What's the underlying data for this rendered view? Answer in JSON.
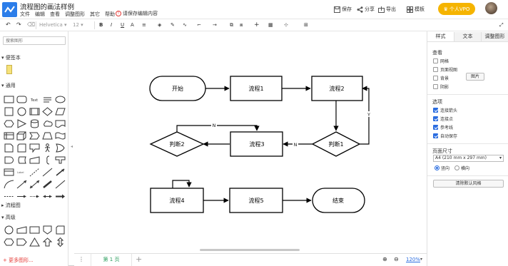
{
  "header": {
    "title": "流程图的画法样例",
    "menu": [
      "文件",
      "编辑",
      "查看",
      "调整图形",
      "其它",
      "帮助"
    ],
    "save_warning": "请保存编辑内容",
    "save": "保存",
    "share": "分享",
    "export": "导出",
    "template": "模板",
    "vip": "个人VPO"
  },
  "toolbar": {
    "font": "Helvetica",
    "font_size": "12"
  },
  "left_panel": {
    "search_placeholder": "搜索图形",
    "sections": [
      "便签本",
      "通用",
      "流程图",
      "高级"
    ],
    "more_shapes": "+ 更多图形..."
  },
  "diagram": {
    "start": "开始",
    "process1": "流程1",
    "process2": "流程2",
    "decision1": "判断1",
    "process3": "流程3",
    "decision2": "判断2",
    "process4": "流程4",
    "process5": "流程5",
    "end": "结束",
    "label_n1": "N",
    "label_n2": "N",
    "label_y": "Y"
  },
  "bottom": {
    "page_tab": "第 1 页",
    "zoom": "120%"
  },
  "right_panel": {
    "tabs": [
      "样式",
      "文本",
      "调整图形"
    ],
    "view_section": "查看",
    "view_options": [
      {
        "label": "网格",
        "checked": false
      },
      {
        "label": "页面视图",
        "checked": false
      },
      {
        "label": "背景",
        "checked": false
      },
      {
        "label": "阴影",
        "checked": false
      }
    ],
    "image_button": "图片",
    "options_section": "选项",
    "options": [
      {
        "label": "连接箭头",
        "checked": true
      },
      {
        "label": "连接点",
        "checked": true
      },
      {
        "label": "参考线",
        "checked": true
      },
      {
        "label": "自动保存",
        "checked": true
      }
    ],
    "page_size_section": "页面尺寸",
    "page_size_value": "A4 (210 mm x 297 mm)",
    "orientation_portrait": "竖向",
    "orientation_landscape": "横向",
    "reset_button": "清除默认风格"
  }
}
